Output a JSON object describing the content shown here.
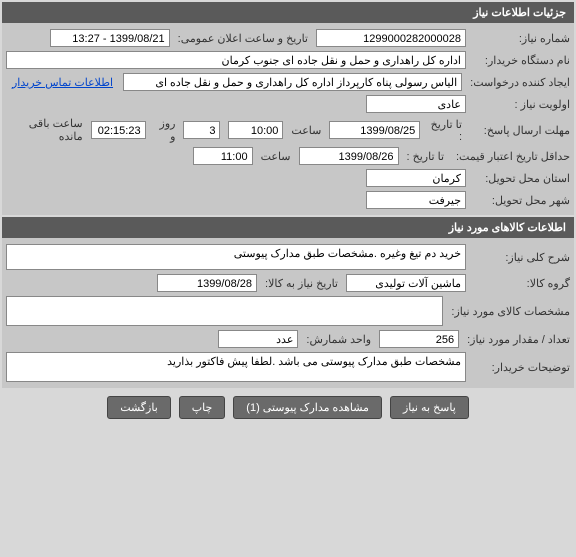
{
  "sections": {
    "need_info": {
      "title": "جزئیات اطلاعات نیاز",
      "need_number_label": "شماره نیاز:",
      "need_number": "1299000282000028",
      "public_ann_label": "تاریخ و ساعت اعلان عمومی:",
      "public_ann": "1399/08/21 - 13:27",
      "org_label": "نام دستگاه خریدار:",
      "org": "اداره کل راهداری و حمل و نقل جاده ای جنوب کرمان",
      "creator_label": "ایجاد کننده درخواست:",
      "creator": "الیاس رسولی پناه کارپرداز اداره کل راهداری و حمل و نقل جاده ای جنوب کرمان",
      "contact_link": "اطلاعات تماس خریدار",
      "priority_label": "اولویت نیاز :",
      "priority": "عادی",
      "deadline_label": "مهلت ارسال پاسخ:",
      "to_date_label": "تا تاریخ :",
      "deadline_date": "1399/08/25",
      "time_label": "ساعت",
      "deadline_time": "10:00",
      "days_remaining": "3",
      "days_label": "روز و",
      "time_remaining": "02:15:23",
      "remaining_label": "ساعت باقی مانده",
      "validity_label": "حداقل تاریخ اعتبار قیمت:",
      "validity_to_label": "تا تاریخ :",
      "validity_date": "1399/08/26",
      "validity_time": "11:00",
      "province_label": "استان محل تحویل:",
      "province": "کرمان",
      "city_label": "شهر محل تحویل:",
      "city": "جیرفت"
    },
    "goods_info": {
      "title": "اطلاعات کالاهای مورد نیاز",
      "general_desc_label": "شرح کلی نیاز:",
      "general_desc": "خرید دم تیغ وغیره .مشخصات طبق مدارک پیوستی",
      "group_label": "گروه کالا:",
      "group": "ماشین آلات تولیدی",
      "need_date_label": "تاریخ نیاز به کالا:",
      "need_date": "1399/08/28",
      "spec_label": "مشخصات کالای مورد نیاز:",
      "spec": "",
      "qty_label": "تعداد / مقدار مورد نیاز:",
      "qty": "256",
      "unit_label": "واحد شمارش:",
      "unit": "عدد",
      "buyer_notes_label": "توضیحات خریدار:",
      "buyer_notes": "مشخصات طبق مدارک پیوستی می باشد .لطفا پیش فاکتور بذارید"
    }
  },
  "buttons": {
    "reply": "پاسخ به نیاز",
    "attachments": "مشاهده مدارک پیوستی (1)",
    "print": "چاپ",
    "back": "بازگشت"
  }
}
